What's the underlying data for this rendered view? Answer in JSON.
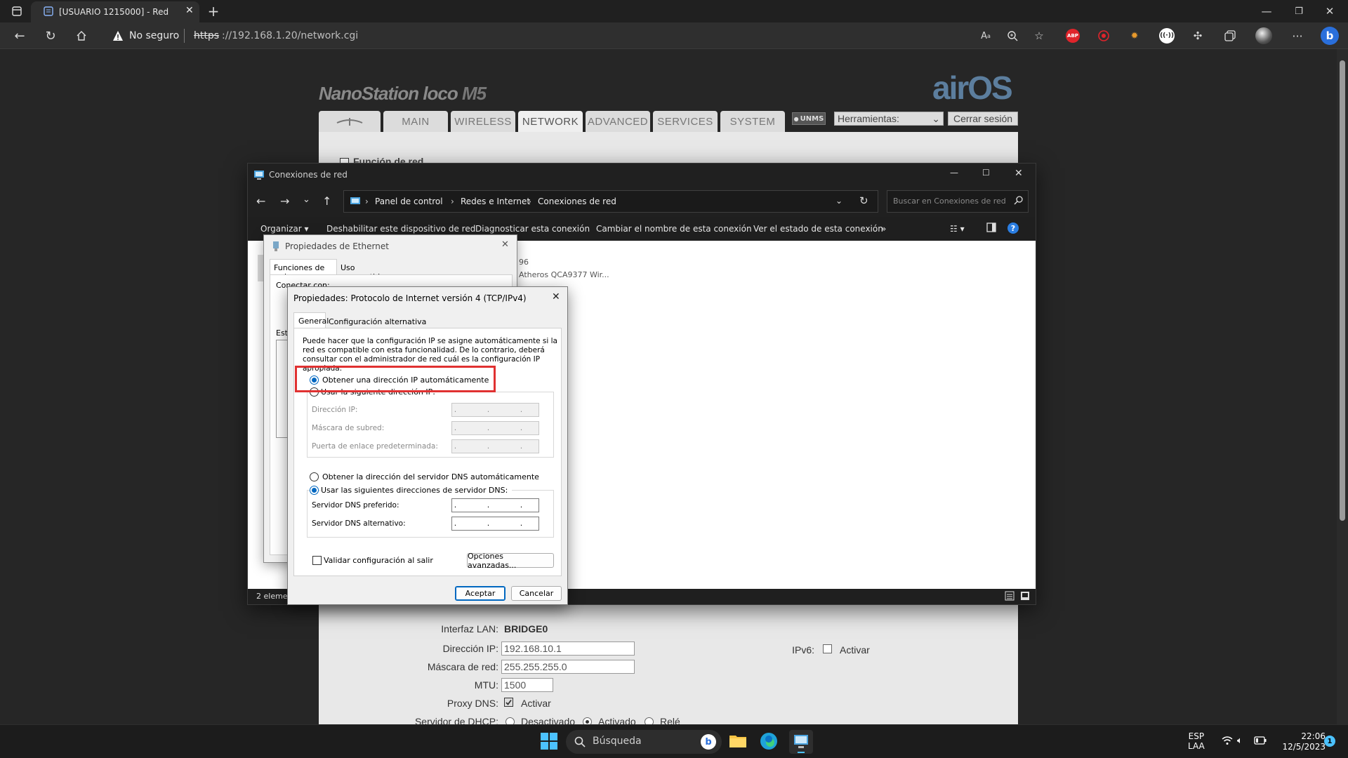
{
  "browser": {
    "tab_title": "[USUARIO 1215000] - Red",
    "security_label": "No seguro",
    "url_scheme": "https",
    "url_rest": "://192.168.1.20/network.cgi",
    "extension_badge": "ABP"
  },
  "airos": {
    "device_name": "NanoStation loco",
    "device_model": "M5",
    "brand": "airOS",
    "tabs": [
      "MAIN",
      "WIRELESS",
      "NETWORK",
      "ADVANCED",
      "SERVICES",
      "SYSTEM"
    ],
    "active_tab": "NETWORK",
    "unms_badge": "UNMS",
    "tools_select": "Herramientas:",
    "logout": "Cerrar sesión",
    "section_peek": "Función de red",
    "lan_interface_label": "Interfaz LAN:",
    "lan_interface_value": "BRIDGE0",
    "ip_label": "Dirección IP:",
    "ip_value": "192.168.10.1",
    "mask_label": "Máscara de red:",
    "mask_value": "255.255.255.0",
    "mtu_label": "MTU:",
    "mtu_value": "1500",
    "proxy_label": "Proxy DNS:",
    "proxy_option": "Activar",
    "dhcp_label": "Servidor de DHCP:",
    "dhcp_options": [
      "Desactivado",
      "Activado",
      "Relé"
    ],
    "ipv6_label": "IPv6:",
    "ipv6_option": "Activar"
  },
  "explorer": {
    "title": "Conexiones de red",
    "breadcrumb": [
      "Panel de control",
      "Redes e Internet",
      "Conexiones de red"
    ],
    "search_placeholder": "Buscar en Conexiones de red",
    "commands": [
      "Organizar",
      "Deshabilitar este dispositivo de red",
      "Diagnosticar esta conexión",
      "Cambiar el nombre de esta conexión",
      "Ver el estado de esta conexión",
      "»"
    ],
    "item_fragment_1": "96",
    "item_fragment_2": "Atheros QCA9377 Wir...",
    "status": "2 elemen"
  },
  "ethernet_dialog": {
    "title": "Propiedades de Ethernet",
    "tabs": [
      "Funciones de red",
      "Uso compartido"
    ],
    "connect_fragment": "Conectar con:",
    "list_fragment": "Est"
  },
  "ipv4_dialog": {
    "title": "Propiedades: Protocolo de Internet versión 4 (TCP/IPv4)",
    "tabs": [
      "General",
      "Configuración alternativa"
    ],
    "intro": [
      "Puede hacer que la configuración IP se asigne automáticamente si la",
      "red es compatible con esta funcionalidad. De lo contrario, deberá",
      "consultar con el administrador de red cuál es la configuración IP",
      "apropiada."
    ],
    "auto_ip": "Obtener una dirección IP automáticamente",
    "manual_ip": "Usar la siguiente dirección IP:",
    "ip_address": "Dirección IP:",
    "subnet_mask": "Máscara de subred:",
    "gateway": "Puerta de enlace predeterminada:",
    "auto_dns": "Obtener la dirección del servidor DNS automáticamente",
    "manual_dns": "Usar las siguientes direcciones de servidor DNS:",
    "preferred_dns": "Servidor DNS preferido:",
    "alternate_dns": "Servidor DNS alternativo:",
    "empty_ip": ". . .",
    "validate": "Validar configuración al salir",
    "advanced": "Opciones avanzadas...",
    "ok": "Aceptar",
    "cancel": "Cancelar",
    "highlight_color": "#e03131"
  },
  "taskbar": {
    "search": "Búsqueda",
    "lang_top": "ESP",
    "lang_bottom": "LAA",
    "time": "22:06",
    "date": "12/5/2023",
    "notification_count": "1"
  }
}
